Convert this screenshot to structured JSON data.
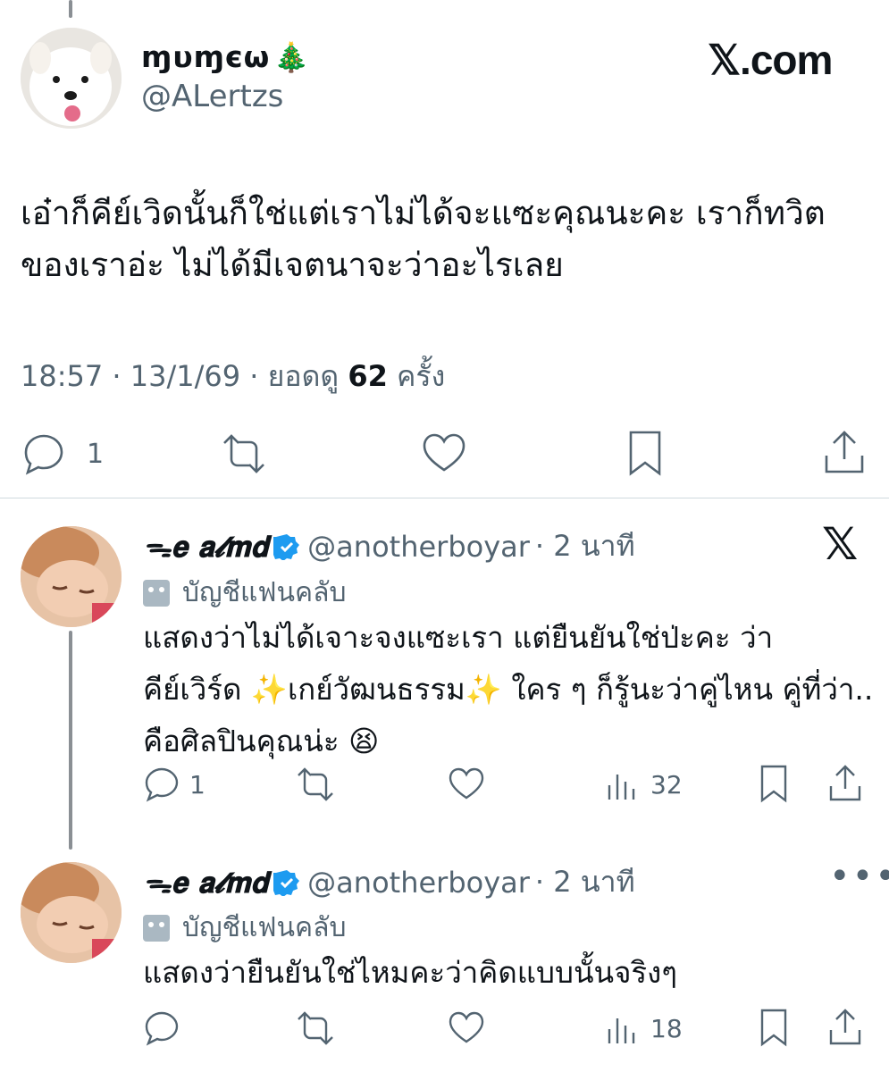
{
  "main_tweet": {
    "display_name": "ɱυɱєω",
    "name_emoji": "🎄",
    "handle": "@ALertzs",
    "brand": "𝕏.com",
    "text": "เอ๋าก็คีย์เวิดนั้นก็ใช่แต่เราไม่ได้จะแซะคุณนะคะ เราก็ทวิตของเราอ่ะ ไม่ได้มีเจตนาจะว่าอะไรเลย",
    "time": "18:57",
    "date": "13/1/69",
    "views_label": "ยอดดู",
    "views_count": "62",
    "views_unit": "ครั้ง",
    "reply_count": "1",
    "accent": "#1d9bf0"
  },
  "replies": [
    {
      "display_name": "ᯓ𝐞 𝐚𝓵𝐦𝐝",
      "handle": "@anotherboyar",
      "time": "· 2 นาที",
      "fan_label": "บัญชีแฟนคลับ",
      "text": "แสดงว่าไม่ได้เจาะจงแซะเรา แต่ยืนยันใช่ป่ะคะ ว่า คีย์เวิร์ด ✨เกย์วัฒนธรรม✨ ใคร ๆ ก็รู้นะว่าคู่ไหน คู่ที่ว่า.. คือศิลปินคุณน่ะ 😫",
      "reply_count": "1",
      "views_count": "32",
      "corner": "𝕏"
    },
    {
      "display_name": "ᯓ𝐞 𝐚𝓵𝐦𝐝",
      "handle": "@anotherboyar",
      "time": "· 2 นาที",
      "fan_label": "บัญชีแฟนคลับ",
      "text": "แสดงว่ายืนยันใช่ไหมคะว่าคิดแบบนั้นจริงๆ",
      "views_count": "18",
      "corner": "•••"
    }
  ]
}
